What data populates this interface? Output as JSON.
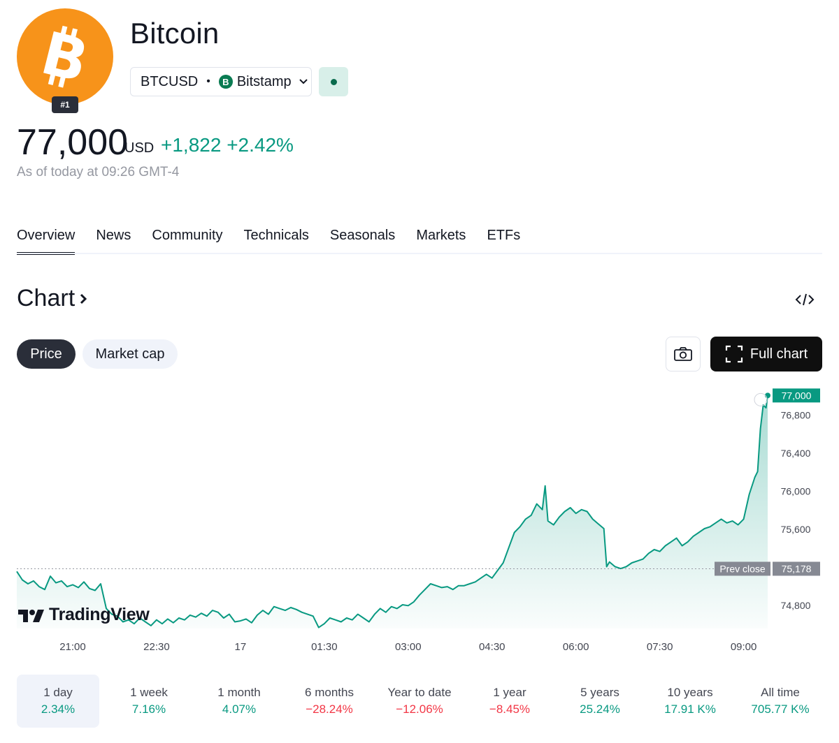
{
  "header": {
    "name": "Bitcoin",
    "rank": "#1",
    "symbol": "BTCUSD",
    "exchange": "Bitstamp",
    "price": "77,000",
    "currency": "USD",
    "change": "+1,822 +2.42%",
    "as_of": "As of today at 09:26 GMT-4"
  },
  "tabs": [
    "Overview",
    "News",
    "Community",
    "Technicals",
    "Seasonals",
    "Markets",
    "ETFs"
  ],
  "section": {
    "title": "Chart",
    "seg_price": "Price",
    "seg_market_cap": "Market cap",
    "full_chart": "Full chart"
  },
  "colors": {
    "brand_orange": "#f7931a",
    "positive": "#089981",
    "negative": "#f23645",
    "line": "#089981"
  },
  "chart_data": {
    "type": "area",
    "prev_close_label": "Prev close",
    "prev_close": 75178,
    "last_price_label": "77,000",
    "last_price": 77000,
    "ylim": [
      74550,
      77120
    ],
    "y_ticks": [
      74800,
      75600,
      76000,
      76400,
      76800
    ],
    "y_tick_labels": [
      "74,800",
      "75,600",
      "76,000",
      "76,400",
      "76,800"
    ],
    "x_ticks": [
      "21:00",
      "22:30",
      "17",
      "01:30",
      "03:00",
      "04:30",
      "06:00",
      "07:30",
      "09:00"
    ],
    "x_tick_hours": [
      0,
      1.5,
      3,
      4.5,
      6,
      7.5,
      9,
      10.5,
      12
    ],
    "x_range_hours": [
      -1,
      12.43
    ],
    "watermark": "TradingView",
    "points": [
      [
        -1.0,
        75150
      ],
      [
        -0.9,
        75060
      ],
      [
        -0.8,
        75020
      ],
      [
        -0.7,
        75050
      ],
      [
        -0.6,
        74990
      ],
      [
        -0.5,
        74960
      ],
      [
        -0.4,
        75100
      ],
      [
        -0.3,
        75030
      ],
      [
        -0.2,
        75050
      ],
      [
        -0.1,
        74990
      ],
      [
        0.0,
        75010
      ],
      [
        0.1,
        74980
      ],
      [
        0.2,
        75040
      ],
      [
        0.3,
        74970
      ],
      [
        0.4,
        74950
      ],
      [
        0.5,
        75020
      ],
      [
        0.6,
        74760
      ],
      [
        0.7,
        74700
      ],
      [
        0.8,
        74680
      ],
      [
        0.9,
        74620
      ],
      [
        1.0,
        74640
      ],
      [
        1.1,
        74600
      ],
      [
        1.2,
        74660
      ],
      [
        1.3,
        74620
      ],
      [
        1.4,
        74580
      ],
      [
        1.5,
        74640
      ],
      [
        1.6,
        74600
      ],
      [
        1.7,
        74650
      ],
      [
        1.8,
        74610
      ],
      [
        1.9,
        74660
      ],
      [
        2.0,
        74640
      ],
      [
        2.1,
        74690
      ],
      [
        2.2,
        74670
      ],
      [
        2.3,
        74710
      ],
      [
        2.4,
        74680
      ],
      [
        2.5,
        74740
      ],
      [
        2.6,
        74720
      ],
      [
        2.7,
        74660
      ],
      [
        2.8,
        74700
      ],
      [
        2.9,
        74620
      ],
      [
        3.0,
        74630
      ],
      [
        3.1,
        74650
      ],
      [
        3.2,
        74610
      ],
      [
        3.3,
        74690
      ],
      [
        3.4,
        74740
      ],
      [
        3.5,
        74700
      ],
      [
        3.6,
        74780
      ],
      [
        3.7,
        74760
      ],
      [
        3.8,
        74740
      ],
      [
        3.9,
        74770
      ],
      [
        4.0,
        74750
      ],
      [
        4.1,
        74720
      ],
      [
        4.2,
        74700
      ],
      [
        4.3,
        74680
      ],
      [
        4.4,
        74560
      ],
      [
        4.5,
        74600
      ],
      [
        4.6,
        74660
      ],
      [
        4.7,
        74640
      ],
      [
        4.8,
        74620
      ],
      [
        4.9,
        74660
      ],
      [
        5.0,
        74640
      ],
      [
        5.1,
        74700
      ],
      [
        5.2,
        74660
      ],
      [
        5.3,
        74620
      ],
      [
        5.4,
        74700
      ],
      [
        5.5,
        74760
      ],
      [
        5.6,
        74720
      ],
      [
        5.7,
        74780
      ],
      [
        5.8,
        74760
      ],
      [
        5.9,
        74800
      ],
      [
        6.0,
        74790
      ],
      [
        6.1,
        74830
      ],
      [
        6.2,
        74900
      ],
      [
        6.3,
        74960
      ],
      [
        6.4,
        75020
      ],
      [
        6.5,
        75000
      ],
      [
        6.6,
        74980
      ],
      [
        6.7,
        74990
      ],
      [
        6.8,
        74960
      ],
      [
        6.9,
        75000
      ],
      [
        7.0,
        75000
      ],
      [
        7.1,
        75020
      ],
      [
        7.2,
        75040
      ],
      [
        7.3,
        75080
      ],
      [
        7.4,
        75120
      ],
      [
        7.5,
        75080
      ],
      [
        7.6,
        75160
      ],
      [
        7.7,
        75240
      ],
      [
        7.8,
        75400
      ],
      [
        7.9,
        75560
      ],
      [
        8.0,
        75620
      ],
      [
        8.1,
        75700
      ],
      [
        8.2,
        75740
      ],
      [
        8.3,
        75860
      ],
      [
        8.4,
        75800
      ],
      [
        8.45,
        76050
      ],
      [
        8.5,
        75680
      ],
      [
        8.6,
        75640
      ],
      [
        8.7,
        75720
      ],
      [
        8.8,
        75780
      ],
      [
        8.9,
        75820
      ],
      [
        9.0,
        75760
      ],
      [
        9.1,
        75800
      ],
      [
        9.2,
        75780
      ],
      [
        9.3,
        75700
      ],
      [
        9.4,
        75650
      ],
      [
        9.5,
        75600
      ],
      [
        9.55,
        75200
      ],
      [
        9.6,
        75250
      ],
      [
        9.7,
        75200
      ],
      [
        9.8,
        75180
      ],
      [
        9.9,
        75200
      ],
      [
        10.0,
        75240
      ],
      [
        10.1,
        75260
      ],
      [
        10.2,
        75280
      ],
      [
        10.3,
        75340
      ],
      [
        10.4,
        75380
      ],
      [
        10.5,
        75360
      ],
      [
        10.6,
        75420
      ],
      [
        10.7,
        75460
      ],
      [
        10.8,
        75500
      ],
      [
        10.9,
        75420
      ],
      [
        11.0,
        75460
      ],
      [
        11.1,
        75520
      ],
      [
        11.2,
        75560
      ],
      [
        11.3,
        75600
      ],
      [
        11.4,
        75620
      ],
      [
        11.5,
        75660
      ],
      [
        11.6,
        75700
      ],
      [
        11.7,
        75660
      ],
      [
        11.8,
        75680
      ],
      [
        11.9,
        75640
      ],
      [
        12.0,
        75700
      ],
      [
        12.1,
        75960
      ],
      [
        12.2,
        76140
      ],
      [
        12.25,
        76200
      ],
      [
        12.3,
        76650
      ],
      [
        12.35,
        76900
      ],
      [
        12.4,
        76870
      ],
      [
        12.43,
        77000
      ]
    ]
  },
  "periods": [
    {
      "label": "1 day",
      "value": "2.34%",
      "dir": "pos"
    },
    {
      "label": "1 week",
      "value": "7.16%",
      "dir": "pos"
    },
    {
      "label": "1 month",
      "value": "4.07%",
      "dir": "pos"
    },
    {
      "label": "6 months",
      "value": "−28.24%",
      "dir": "neg"
    },
    {
      "label": "Year to date",
      "value": "−12.06%",
      "dir": "neg"
    },
    {
      "label": "1 year",
      "value": "−8.45%",
      "dir": "neg"
    },
    {
      "label": "5 years",
      "value": "25.24%",
      "dir": "pos"
    },
    {
      "label": "10 years",
      "value": "17.91 K%",
      "dir": "pos"
    },
    {
      "label": "All time",
      "value": "705.77 K%",
      "dir": "pos"
    }
  ]
}
